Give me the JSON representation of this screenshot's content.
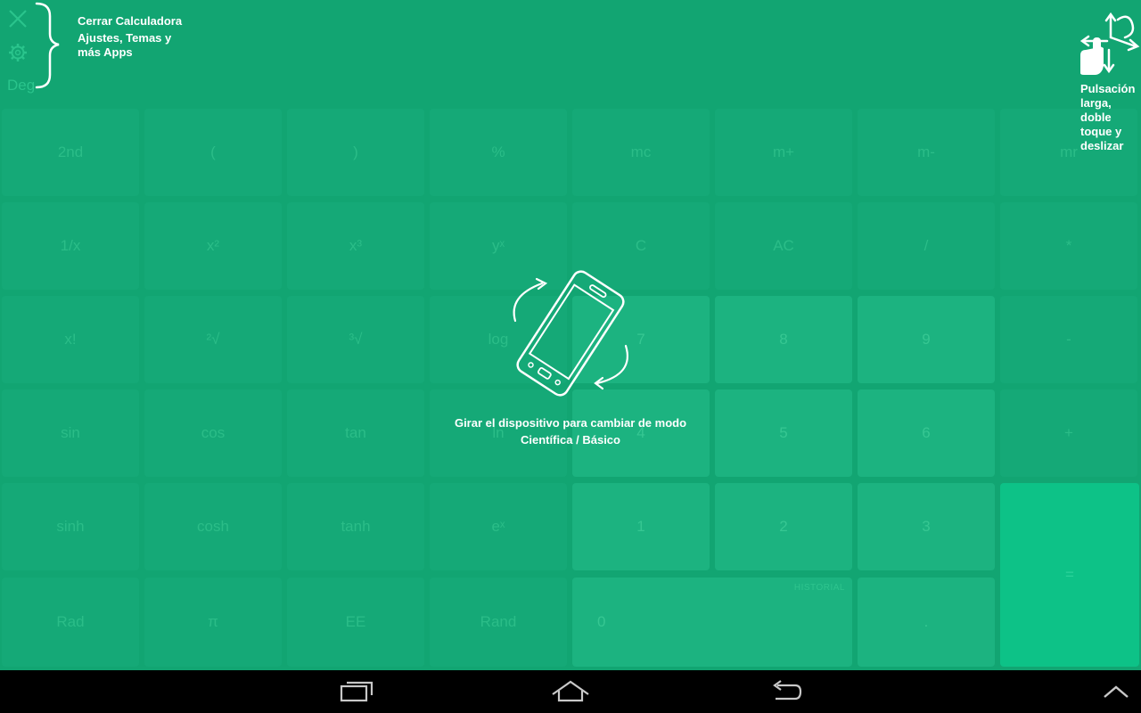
{
  "top_left": {
    "deg_label": "Deg",
    "tip_close": "Cerrar Calculadora",
    "tip_settings_1": "Ajustes, Temas y",
    "tip_settings_2": "más Apps"
  },
  "top_right": {
    "gesture_icon": "hand-gesture-icon",
    "tip_lines": [
      "Pulsación",
      "larga,",
      "doble",
      "toque y",
      "deslizar"
    ]
  },
  "center": {
    "rotate_icon": "rotate-phone-icon",
    "line1": "Girar el dispositivo para cambiar de modo",
    "line2": "Científica / Básico"
  },
  "keys": {
    "r1": [
      "2nd",
      "(",
      ")",
      "%",
      "mc",
      "m+",
      "m-",
      "mr"
    ],
    "r2": [
      "1/x",
      "x²",
      "x³",
      "yˣ",
      "C",
      "AC",
      "/",
      "*"
    ],
    "r3": [
      "x!",
      "²√",
      "³√",
      "log",
      "7",
      "8",
      "9",
      "-"
    ],
    "r4": [
      "sin",
      "cos",
      "tan",
      "ln",
      "4",
      "5",
      "6",
      "+"
    ],
    "r5": [
      "sinh",
      "cosh",
      "tanh",
      "eˣ",
      "1",
      "2",
      "3"
    ],
    "r6": [
      "Rad",
      "π",
      "EE",
      "Rand",
      "0",
      "."
    ],
    "equals": "=",
    "historial": "HISTORIAL"
  },
  "navbar": {
    "recents_icon": "recents-icon",
    "home_icon": "home-icon",
    "back_icon": "back-icon",
    "up_icon": "chevron-up-icon"
  },
  "colors": {
    "background": "#12a572",
    "button": "#15a977",
    "digit_button": "#1cb380",
    "equals_button": "#0dc287",
    "navbar": "#000000"
  }
}
